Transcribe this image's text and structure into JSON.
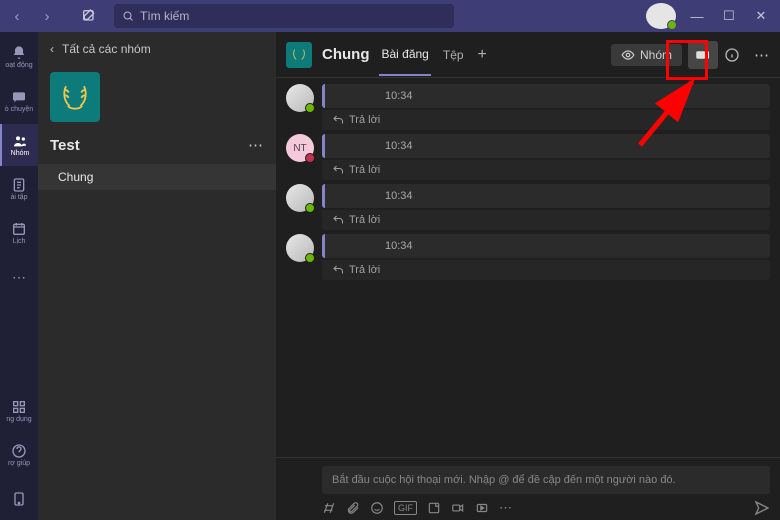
{
  "titlebar": {
    "search_placeholder": "Tìm kiếm"
  },
  "rail": {
    "activity": "oạt động",
    "chat": "ò chuyện",
    "teams": "Nhóm",
    "assignments": "ài tập",
    "calendar": "Lịch",
    "apps": "ng dụng",
    "help": "rợ giúp"
  },
  "sidebar": {
    "back_label": "Tất cả các nhóm",
    "team_name": "Test",
    "channel": "Chung"
  },
  "header": {
    "channel_name": "Chung",
    "tab_posts": "Bài đăng",
    "tab_files": "Tệp",
    "group_btn": "Nhóm"
  },
  "posts": [
    {
      "avatar": "user1",
      "time": "10:34",
      "reply": "Trả lời"
    },
    {
      "avatar": "user2",
      "initials": "NT",
      "time": "10:34",
      "reply": "Trả lời"
    },
    {
      "avatar": "user1",
      "time": "10:34",
      "reply": "Trả lời"
    },
    {
      "avatar": "user1",
      "time": "10:34",
      "reply": "Trả lời"
    }
  ],
  "composer": {
    "placeholder": "Bắt đầu cuộc hội thoại mới. Nhập @ để đề cập đến một người nào đó."
  }
}
